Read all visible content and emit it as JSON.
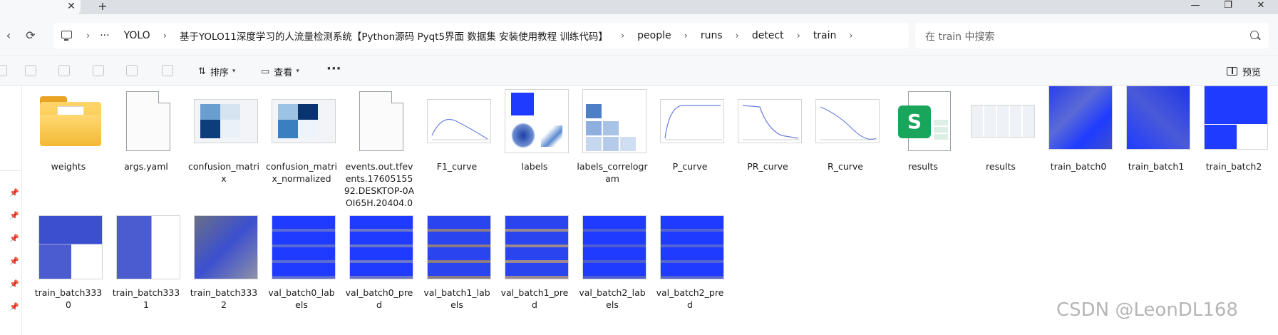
{
  "window": {
    "tab_close": "✕",
    "tab_new": "+",
    "min": "—",
    "max": "❐",
    "close": "✕"
  },
  "nav": {
    "refresh": "⟳",
    "chevron": "›",
    "more": "···"
  },
  "breadcrumbs": [
    "YOLO",
    "基于YOLO11深度学习的人流量检测系统【Python源码 Pyqt5界面 数据集 安装使用教程 训练代码】",
    "people",
    "runs",
    "detect",
    "train"
  ],
  "search": {
    "placeholder": "在 train 中搜索"
  },
  "toolbar": {
    "sort_label": "排序",
    "view_label": "查看",
    "more_label": "···",
    "preview_label": "预览"
  },
  "files": {
    "row1": [
      {
        "name": "weights",
        "type": "folder"
      },
      {
        "name": "args.yaml",
        "type": "document"
      },
      {
        "name": "confusion_matrix",
        "type": "image"
      },
      {
        "name": "confusion_matrix_normalized",
        "type": "image"
      },
      {
        "name": "events.out.tfevents.1760515592.DESKTOP-0AOI65H.20404.0",
        "type": "document"
      },
      {
        "name": "F1_curve",
        "type": "image"
      },
      {
        "name": "labels",
        "type": "image"
      },
      {
        "name": "labels_correlogram",
        "type": "image"
      },
      {
        "name": "P_curve",
        "type": "image"
      },
      {
        "name": "PR_curve",
        "type": "image"
      },
      {
        "name": "R_curve",
        "type": "image"
      },
      {
        "name": "results",
        "type": "spreadsheet"
      },
      {
        "name": "results",
        "type": "image"
      },
      {
        "name": "train_batch0",
        "type": "image"
      },
      {
        "name": "train_batch1",
        "type": "image"
      },
      {
        "name": "train_batch2",
        "type": "image"
      }
    ],
    "row2": [
      {
        "name": "train_batch3330",
        "type": "image"
      },
      {
        "name": "train_batch3331",
        "type": "image"
      },
      {
        "name": "train_batch3332",
        "type": "image"
      },
      {
        "name": "val_batch0_labels",
        "type": "image"
      },
      {
        "name": "val_batch0_pred",
        "type": "image"
      },
      {
        "name": "val_batch1_labels",
        "type": "image"
      },
      {
        "name": "val_batch1_pred",
        "type": "image"
      },
      {
        "name": "val_batch2_labels",
        "type": "image"
      },
      {
        "name": "val_batch2_pred",
        "type": "image"
      }
    ]
  },
  "spreadsheet_badge": "S",
  "watermark": "CSDN @LeonDL168",
  "colors": {
    "accent_blue": "#1f3bff",
    "folder_yellow": "#f7c044",
    "excel_green": "#1aa55c"
  }
}
